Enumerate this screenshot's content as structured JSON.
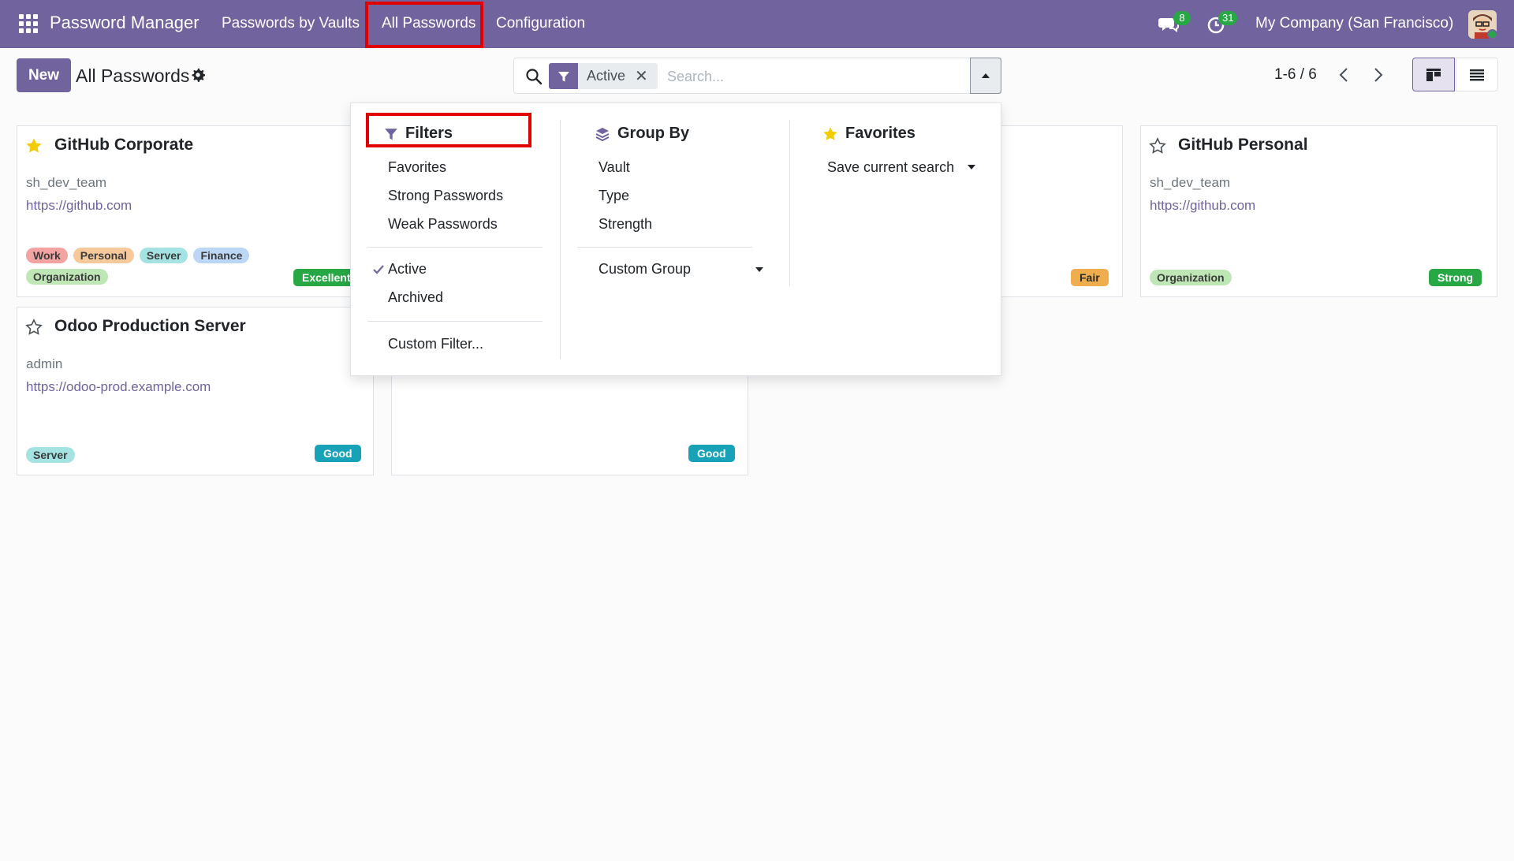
{
  "navbar": {
    "brand": "Password Manager",
    "menu": [
      "Passwords by Vaults",
      "All Passwords",
      "Configuration"
    ],
    "messages_count": "8",
    "activities_count": "31",
    "company": "My Company (San Francisco)"
  },
  "control": {
    "new_label": "New",
    "title": "All Passwords",
    "facet_label": "Active",
    "search_placeholder": "Search...",
    "pager": "1-6 / 6"
  },
  "cards": [
    {
      "title": "GitHub Corporate",
      "user": "sh_dev_team",
      "url": "https://github.com",
      "starred": true,
      "tags": [
        "Work",
        "Personal",
        "Server",
        "Finance",
        "Organization"
      ],
      "strength": "Excellent"
    },
    {
      "title": "GitHub Personal",
      "user": "sh_dev_team",
      "url": "https://github.com",
      "starred": false,
      "tags": [
        "Organization"
      ],
      "strength": "Strong"
    },
    {
      "title": "Odoo Production Server",
      "user": "admin",
      "url": "https://odoo-prod.example.com",
      "starred": false,
      "tags": [
        "Server"
      ],
      "strength": "Good"
    },
    {
      "strength": "Good"
    },
    {
      "strength": "Fair"
    }
  ],
  "dropdown": {
    "filters_head": "Filters",
    "filters": [
      "Favorites",
      "Strong Passwords",
      "Weak Passwords"
    ],
    "status": [
      "Active",
      "Archived"
    ],
    "custom_filter": "Custom Filter...",
    "groupby_head": "Group By",
    "groupby": [
      "Vault",
      "Type",
      "Strength"
    ],
    "custom_group": "Custom Group",
    "favorites_head": "Favorites",
    "save_search": "Save current search"
  },
  "colors": {
    "brand": "#71639e",
    "tag_work": "#f4a3a3",
    "tag_personal": "#f6c99a",
    "tag_server": "#a5e3e3",
    "tag_finance": "#bcd6f5",
    "tag_organization": "#bfe6b5",
    "excellent": "#28a745",
    "strong": "#28a745",
    "good": "#17a2b8",
    "fair": "#f0ad4e"
  }
}
